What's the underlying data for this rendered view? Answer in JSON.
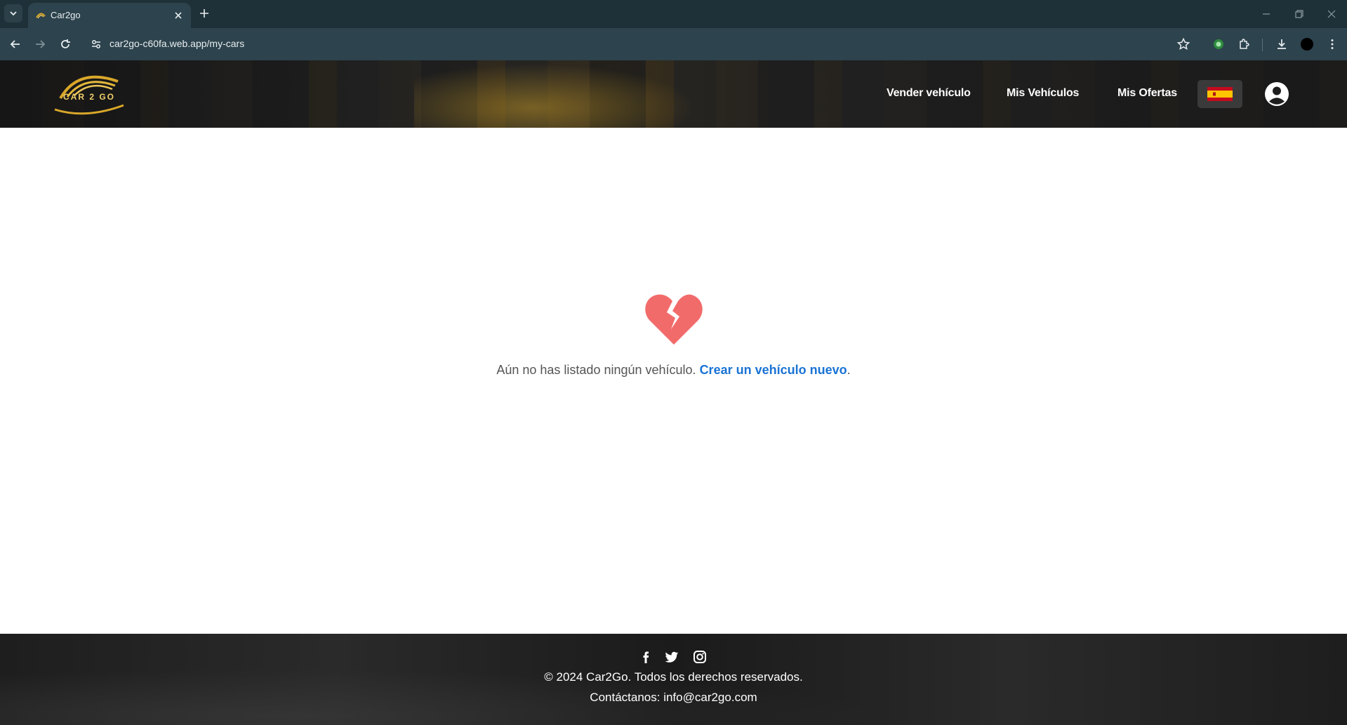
{
  "browser": {
    "tab_title": "Car2go",
    "url": "car2go-c60fa.web.app/my-cars"
  },
  "header": {
    "logo_text": "CAR 2 GO",
    "nav": {
      "sell": "Vender vehículo",
      "my_vehicles": "Mis Vehículos",
      "my_offers": "Mis Ofertas"
    },
    "language": "es"
  },
  "empty_state": {
    "icon": "broken-heart-icon",
    "message": "Aún no has listado ningún vehículo.",
    "link_text": "Crear un vehículo nuevo",
    "suffix": "."
  },
  "footer": {
    "social": [
      "facebook-icon",
      "twitter-icon",
      "instagram-icon"
    ],
    "copyright": "© 2024 Car2Go. Todos los derechos reservados.",
    "contact": "Contáctanos: info@car2go.com"
  },
  "colors": {
    "link": "#1a73d4",
    "broken_heart": "#f26b6b"
  }
}
